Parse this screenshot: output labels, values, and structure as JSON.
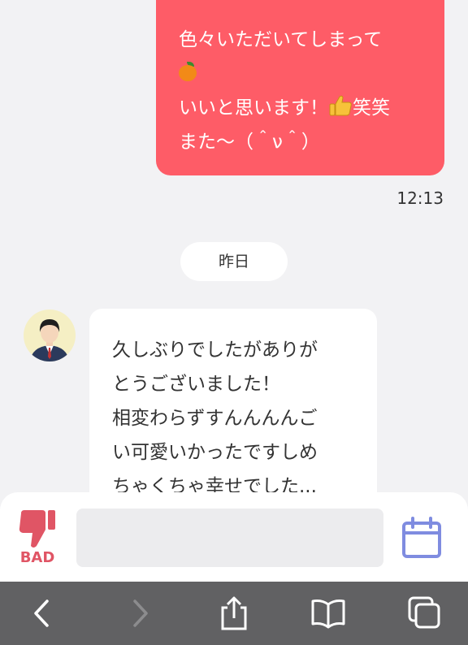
{
  "outgoing": {
    "lines": [
      "色々いただいてしまって",
      "いいと思います！",
      "笑笑",
      "また〜（＾ν＾）"
    ],
    "emoji": [
      "orange-icon",
      "thumbs-up-icon"
    ],
    "time": "12:13"
  },
  "date_separator": "昨日",
  "incoming": {
    "lines": [
      "久しぶりでしたがありが",
      "とうございました！",
      "相変わらずすんんんんご",
      "い可愛いかったですしめ",
      "ちゃくちゃ幸せでした..."
    ]
  },
  "input_bar": {
    "bad_label": "BAD",
    "message_value": ""
  },
  "colors": {
    "outgoing_bubble": "#fe5c67",
    "background": "#f2f2f4",
    "bad_accent": "#e05565",
    "calendar_accent": "#7f8ce0",
    "browser_toolbar": "#616163"
  },
  "browser_toolbar": {
    "items": [
      "back-icon",
      "forward-icon",
      "share-icon",
      "bookmarks-icon",
      "tabs-icon"
    ]
  }
}
